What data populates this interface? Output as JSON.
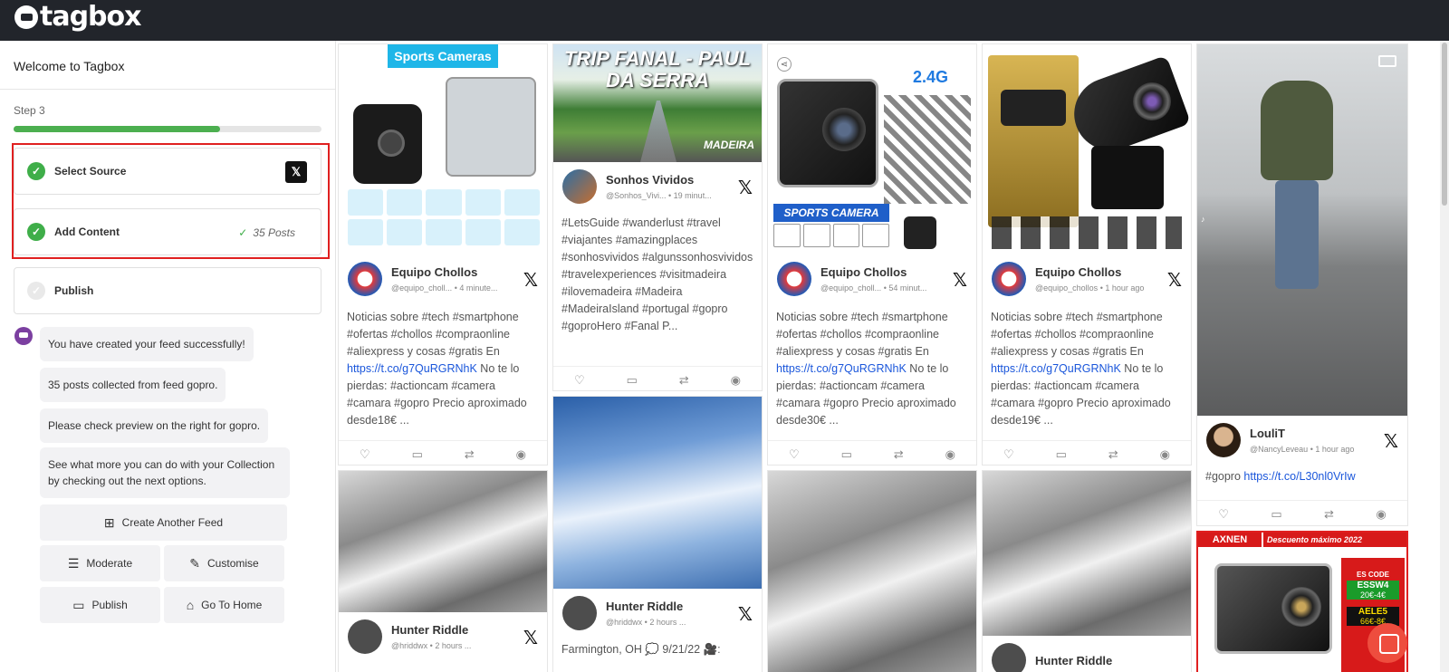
{
  "app": {
    "logo_text": "tagbox"
  },
  "sidebar": {
    "title": "Welcome to Tagbox",
    "step_label": "Step 3",
    "progress_fraction": 0.67,
    "steps": [
      {
        "label": "Select Source",
        "done": true,
        "badge_icon": "x-logo-icon"
      },
      {
        "label": "Add Content",
        "done": true,
        "count_text": "35 Posts"
      },
      {
        "label": "Publish",
        "done": false
      }
    ],
    "messages": [
      "You have created your feed successfully!",
      "35 posts collected from feed gopro.",
      "Please check preview on the right for gopro.",
      "See what more you can do with your Collection by checking out the next options."
    ],
    "actions": {
      "create": "Create Another Feed",
      "moderate": "Moderate",
      "customise": "Customise",
      "publish": "Publish",
      "home": "Go To Home"
    }
  },
  "feed": {
    "cards": [
      {
        "author": "Equipo Chollos",
        "handle": "@equipo_choll...",
        "time": "4 minute...",
        "banner": "Sports Cameras",
        "text_pre": "Noticias sobre #tech #smartphone #ofertas #chollos #compraonline #aliexpress y cosas #gratis En ",
        "link": "https://t.co/g7QuRGRNhK",
        "text_post": " No te lo pierdas: #actioncam #camera #camara #gopro Precio aproximado desde18€ ..."
      },
      {
        "author": "Sonhos Vividos",
        "handle": "@Sonhos_Vivi...",
        "time": "19 minut...",
        "banner": "TRIP FANAL - PAUL DA SERRA",
        "sub_banner": "MADEIRA",
        "text_pre": "#LetsGuide #wanderlust #travel #viajantes #amazingplaces #sonhosvividos #algunssonhosvividos #travelexperiences #visitmadeira #ilovemadeira #Madeira #MadeiraIsland #portugal #gopro #goproHero #Fanal P...",
        "link": "",
        "text_post": ""
      },
      {
        "author": "Equipo Chollos",
        "handle": "@equipo_choll...",
        "time": "54 minut...",
        "banner": "SPORTS CAMERA",
        "badge": "2.4G",
        "text_pre": "Noticias sobre #tech #smartphone #ofertas #chollos #compraonline #aliexpress y cosas #gratis En ",
        "link": "https://t.co/g7QuRGRNhK",
        "text_post": " No te lo pierdas: #actioncam #camera #camara #gopro Precio aproximado desde30€ ..."
      },
      {
        "author": "Equipo Chollos",
        "handle": "@equipo_chollos",
        "time": "1 hour ago",
        "text_pre": "Noticias sobre #tech #smartphone #ofertas #chollos #compraonline #aliexpress y cosas #gratis En ",
        "link": "https://t.co/g7QuRGRNhK",
        "text_post": " No te lo pierdas: #actioncam #camera #camara #gopro Precio aproximado desde19€ ..."
      },
      {
        "author": "LouliT",
        "handle": "@NancyLeveau",
        "time": "1 hour ago",
        "text_pre": "#gopro ",
        "link": "https://t.co/L30nl0VrIw",
        "text_post": ""
      },
      {
        "author": "Hunter Riddle",
        "handle": "@hriddwx",
        "time": "2 hours ...",
        "text_pre": "",
        "link": "",
        "text_post": ""
      },
      {
        "author": "Hunter Riddle",
        "handle": "@hriddwx",
        "time": "2 hours ...",
        "text_pre": "Farmington, OH 💭 9/21/22 🎥:",
        "link": "",
        "text_post": ""
      },
      {
        "author": "Hunter Riddle",
        "handle": "",
        "time": "",
        "text_pre": "",
        "link": "",
        "text_post": ""
      },
      {
        "banner": "AXNEN",
        "promo": "Descuento máximo 2022",
        "code_label": "ES CODE",
        "code": "ESSW4",
        "code_price": "20€-4€",
        "code2": "AELE5",
        "code2_price": "66€-8€"
      }
    ]
  },
  "colors": {
    "accent_green": "#3fae49",
    "highlight_red": "#e02020",
    "link_blue": "#1a56db",
    "topbar": "#22252b"
  }
}
